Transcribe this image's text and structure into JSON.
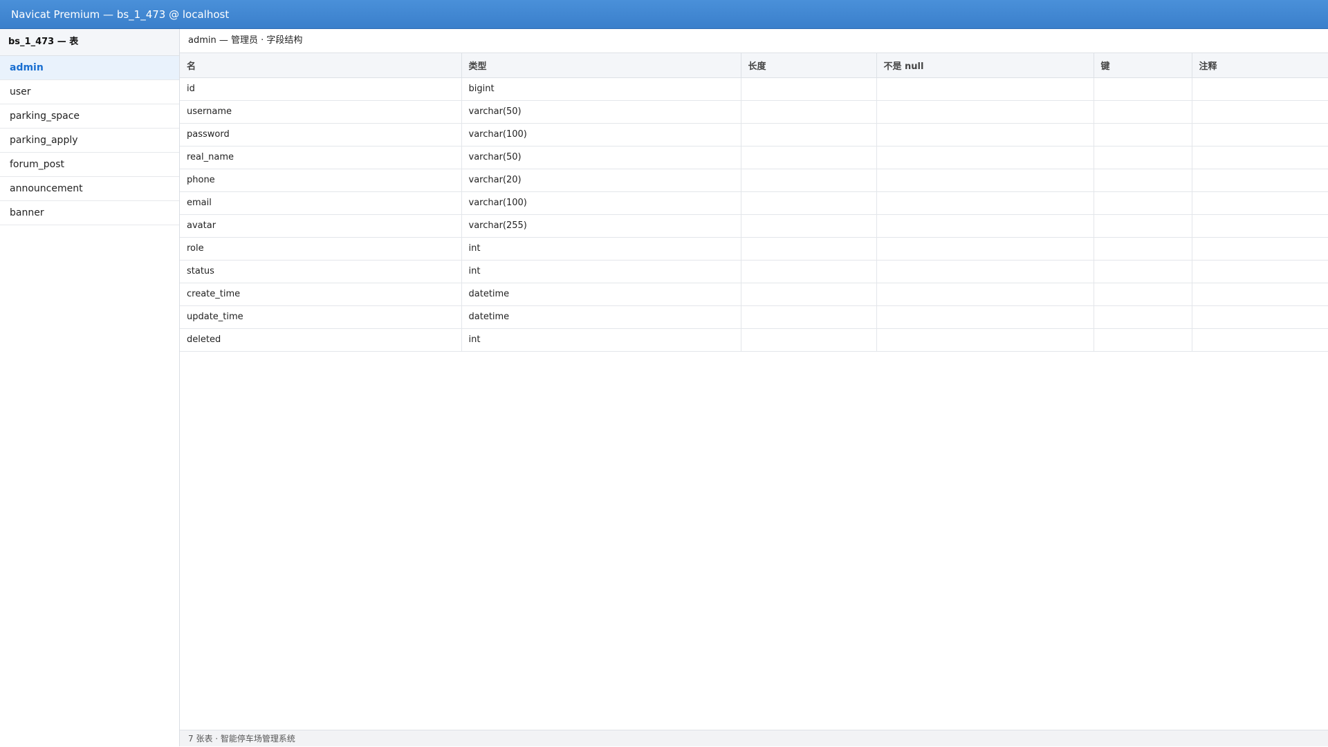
{
  "window": {
    "title": "Navicat Premium — bs_1_473 @ localhost"
  },
  "sidebar": {
    "header": "bs_1_473 — 表",
    "items": [
      {
        "label": "admin",
        "active": true
      },
      {
        "label": "user",
        "active": false
      },
      {
        "label": "parking_space",
        "active": false
      },
      {
        "label": "parking_apply",
        "active": false
      },
      {
        "label": "forum_post",
        "active": false
      },
      {
        "label": "announcement",
        "active": false
      },
      {
        "label": "banner",
        "active": false
      }
    ]
  },
  "main": {
    "header": "admin — 管理员 · 字段结构",
    "table": {
      "columns": [
        "名",
        "类型",
        "长度",
        "不是 null",
        "键",
        "注释"
      ],
      "rows": [
        [
          "id",
          "bigint",
          "",
          "",
          "",
          ""
        ],
        [
          "username",
          "varchar(50)",
          "",
          "",
          "",
          ""
        ],
        [
          "password",
          "varchar(100)",
          "",
          "",
          "",
          ""
        ],
        [
          "real_name",
          "varchar(50)",
          "",
          "",
          "",
          ""
        ],
        [
          "phone",
          "varchar(20)",
          "",
          "",
          "",
          ""
        ],
        [
          "email",
          "varchar(100)",
          "",
          "",
          "",
          ""
        ],
        [
          "avatar",
          "varchar(255)",
          "",
          "",
          "",
          ""
        ],
        [
          "role",
          "int",
          "",
          "",
          "",
          ""
        ],
        [
          "status",
          "int",
          "",
          "",
          "",
          ""
        ],
        [
          "create_time",
          "datetime",
          "",
          "",
          "",
          ""
        ],
        [
          "update_time",
          "datetime",
          "",
          "",
          "",
          ""
        ],
        [
          "deleted",
          "int",
          "",
          "",
          "",
          ""
        ]
      ]
    }
  },
  "statusbar": {
    "text": "7 张表 · 智能停车场管理系统"
  },
  "colors": {
    "titlebar": "#3a7fcb",
    "accent": "#1a6fd1",
    "active_bg": "#e9f2fc"
  }
}
